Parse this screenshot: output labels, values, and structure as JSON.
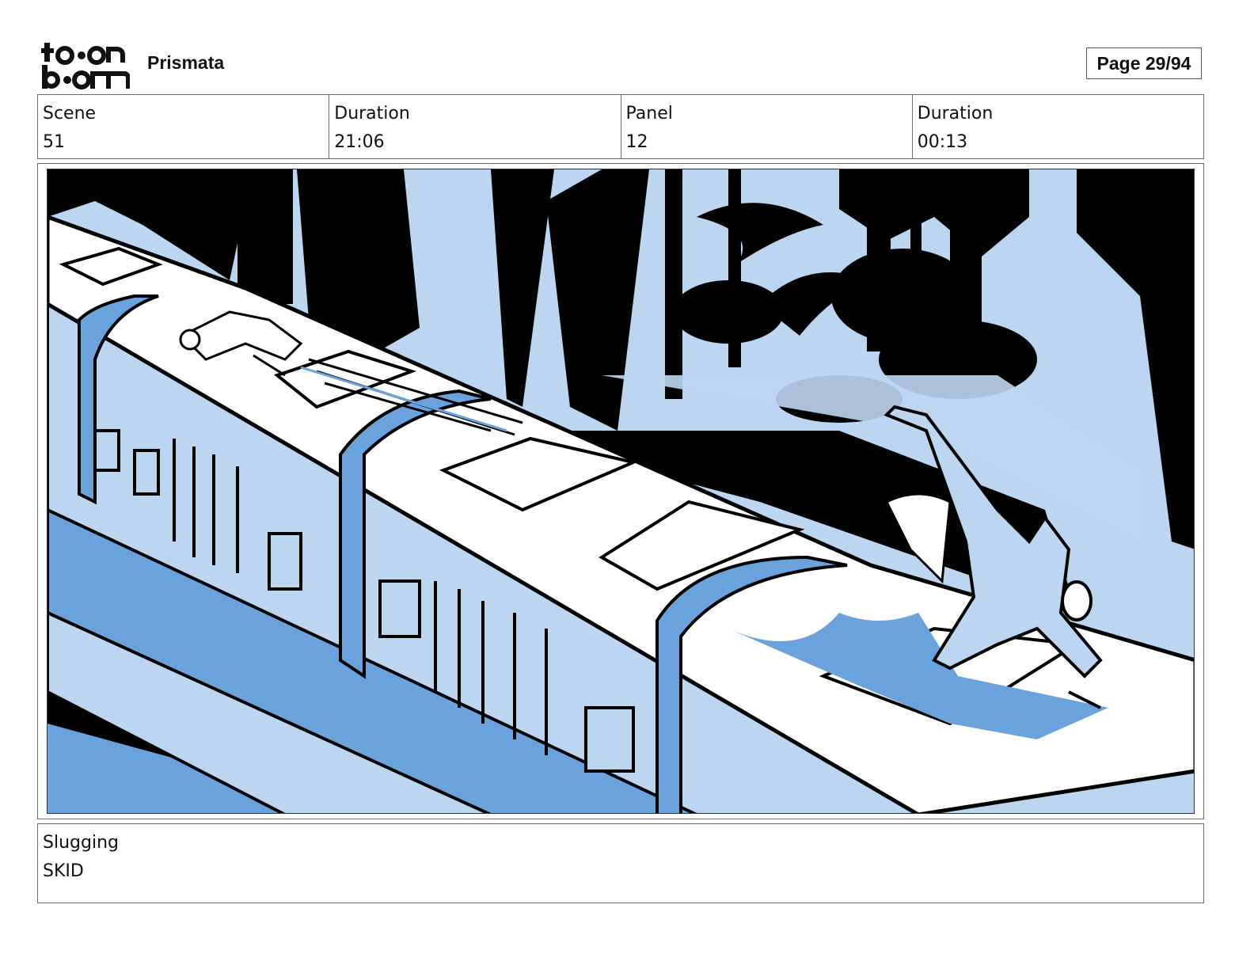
{
  "brand": {
    "logo_text_top": "toon",
    "logo_text_bottom": "boom",
    "project": "Prismata"
  },
  "page_indicator": "Page 29/94",
  "info": {
    "scene_label": "Scene",
    "scene_value": "51",
    "scene_duration_label": "Duration",
    "scene_duration_value": "21:06",
    "panel_label": "Panel",
    "panel_value": "12",
    "panel_duration_label": "Duration",
    "panel_duration_value": "00:13"
  },
  "slugging": {
    "label": "Slugging",
    "value": "SKID"
  },
  "colors": {
    "light_blue": "#bcd6f1",
    "mid_blue": "#6aa3dc",
    "ink": "#000000",
    "paper": "#ffffff"
  }
}
